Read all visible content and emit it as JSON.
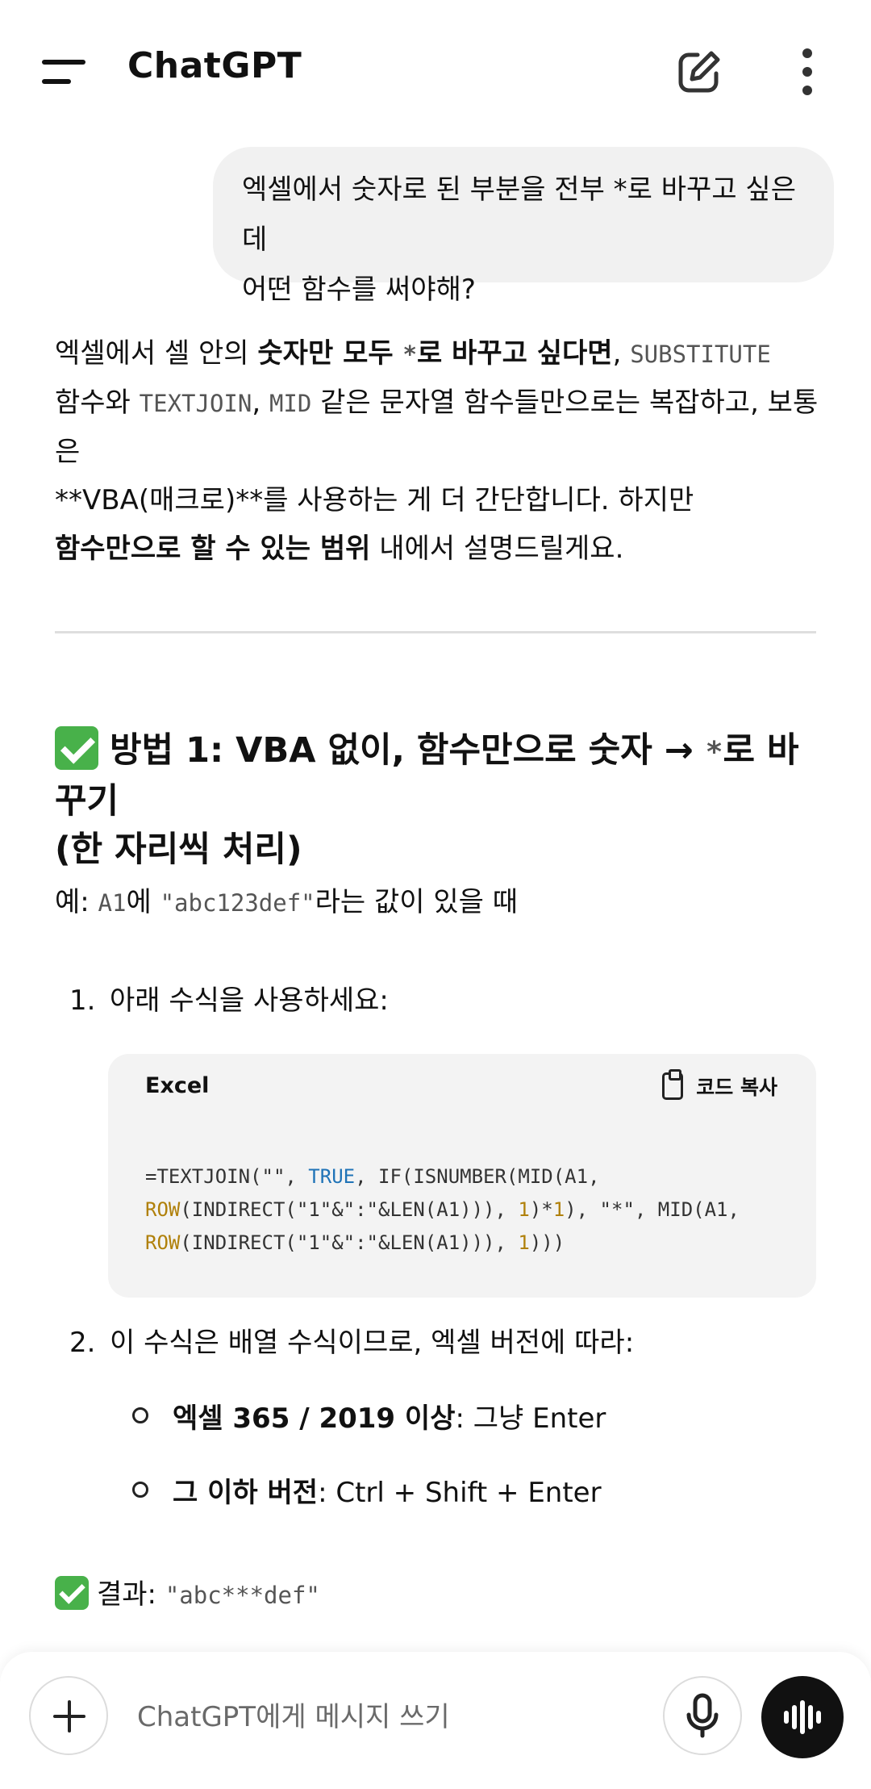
{
  "header": {
    "title": "ChatGPT"
  },
  "user_message": {
    "line1": "엑셀에서 숫자로 된 부분을 전부 *로 바꾸고 싶은데",
    "line2": "어떤 함수를 써야해?"
  },
  "answer": {
    "p1_a": "엑셀에서 셀 안의 ",
    "p1_b": "숫자만 모두 ",
    "p1_c": "*",
    "p1_d": "로 바꾸고 싶다면",
    "p1_e": ", ",
    "p1_f": "SUBSTITUTE",
    "p2_a": "함수와 ",
    "p2_b": "TEXTJOIN",
    "p2_c": ", ",
    "p2_d": "MID",
    "p2_e": " 같은 문자열 함수들만으로는 복잡하고, 보통은",
    "p3": "**VBA(매크로)**를 사용하는 게 더 간단합니다. 하지만",
    "p4_a": "함수만으로 할 수 있는 범위",
    "p4_b": " 내에서 설명드릴게요."
  },
  "method1": {
    "heading_a": "방법 1: VBA 없이, 함수만으로 숫자 → ",
    "heading_star": "*",
    "heading_b": "로 바꾸기",
    "heading_line2": "(한 자리씩 처리)",
    "example_a": "예: ",
    "example_cell": "A1",
    "example_b": "에 ",
    "example_value": "\"abc123def\"",
    "example_c": "라는 값이 있을 때",
    "step1_num": "1.",
    "step1_text": "아래 수식을 사용하세요:",
    "code_lang": "Excel",
    "copy_label": "코드 복사",
    "code": {
      "l1_a": "=TEXTJOIN(\"\", ",
      "l1_true": "TRUE",
      "l1_b": ", IF(ISNUMBER(MID(A1,",
      "l2_row": "ROW",
      "l2_a": "(INDIRECT(\"1\"&\":\"&LEN(A1))), ",
      "l2_one": "1",
      "l2_b": ")*",
      "l2_one2": "1",
      "l2_c": "), \"*\", MID(A1,",
      "l3_row": "ROW",
      "l3_a": "(INDIRECT(\"1\"&\":\"&LEN(A1))), ",
      "l3_one": "1",
      "l3_b": ")))"
    },
    "step2_num": "2.",
    "step2_text": "이 수식은 배열 수식이므로, 엑셀 버전에 따라:",
    "bullet1_bold": "엑셀 365 / 2019 이상",
    "bullet1_rest": ": 그냥 Enter",
    "bullet2_bold": "그 이하 버전",
    "bullet2_rest": ": Ctrl + Shift + Enter",
    "result_label": "결과: ",
    "result_value": "\"abc***def\""
  },
  "composer": {
    "placeholder": "ChatGPT에게 메시지 쓰기"
  }
}
